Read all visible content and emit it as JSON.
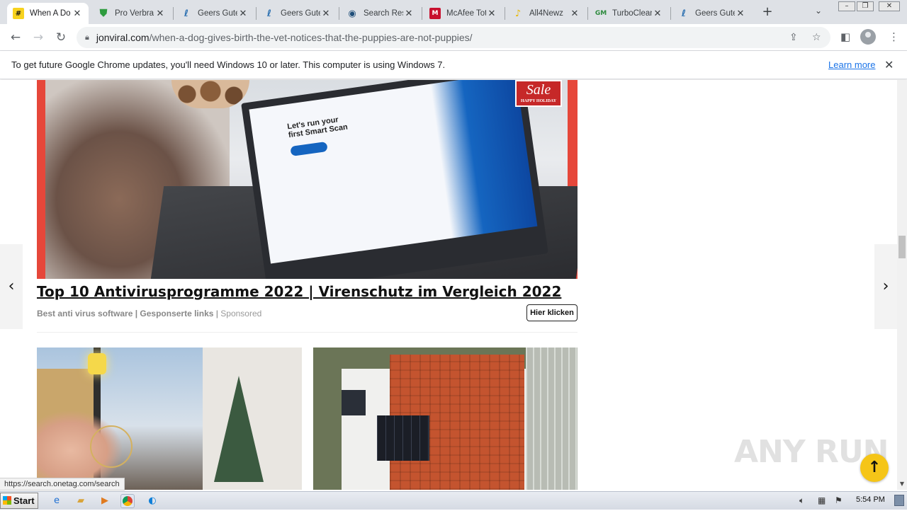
{
  "browser": {
    "tabs": [
      {
        "title": "When A Do",
        "favicon": "hash-icon",
        "active": true
      },
      {
        "title": "Pro Verbra",
        "favicon": "shield-check-icon",
        "active": false
      },
      {
        "title": "Geers Gute",
        "favicon": "ear-icon",
        "active": false
      },
      {
        "title": "Geers Gute",
        "favicon": "ear-icon",
        "active": false
      },
      {
        "title": "Search Res",
        "favicon": "search-globe-icon",
        "active": false
      },
      {
        "title": "McAfee Tot",
        "favicon": "mcafee-icon",
        "active": false
      },
      {
        "title": "All4Newz",
        "favicon": "bell-icon",
        "active": false
      },
      {
        "title": "TurboClean",
        "favicon": "gm-icon",
        "active": false
      },
      {
        "title": "Geers Gute",
        "favicon": "ear-icon",
        "active": false
      }
    ],
    "new_tab_label": "+",
    "url_host": "jonviral.com",
    "url_path": "/when-a-dog-gives-birth-the-vet-notices-that-the-puppies-are-not-puppies/",
    "status_url": "https://search.onetag.com/search"
  },
  "infobar": {
    "message": "To get future Google Chrome updates, you'll need Windows 10 or later. This computer is using Windows 7.",
    "link_label": "Learn more"
  },
  "page": {
    "hero_badge_big": "Sale",
    "hero_badge_small": "HAPPY HOLIDAY",
    "hero_screen_text": "Let's run your first Smart Scan",
    "ad_title": "Top 10 Antivirusprogramme 2022 | Virenschutz im Vergleich 2022",
    "ad_source": "Best anti virus software | Gesponserte links",
    "ad_sponsored": "Sponsored",
    "ad_cta": "Hier klicken",
    "watermark": "ANY RUN"
  },
  "taskbar": {
    "start_label": "Start",
    "clock": "5:54 PM"
  },
  "colors": {
    "ad_red": "#e6473a",
    "back_to_top": "#f5c518",
    "link_blue": "#1a73e8"
  }
}
